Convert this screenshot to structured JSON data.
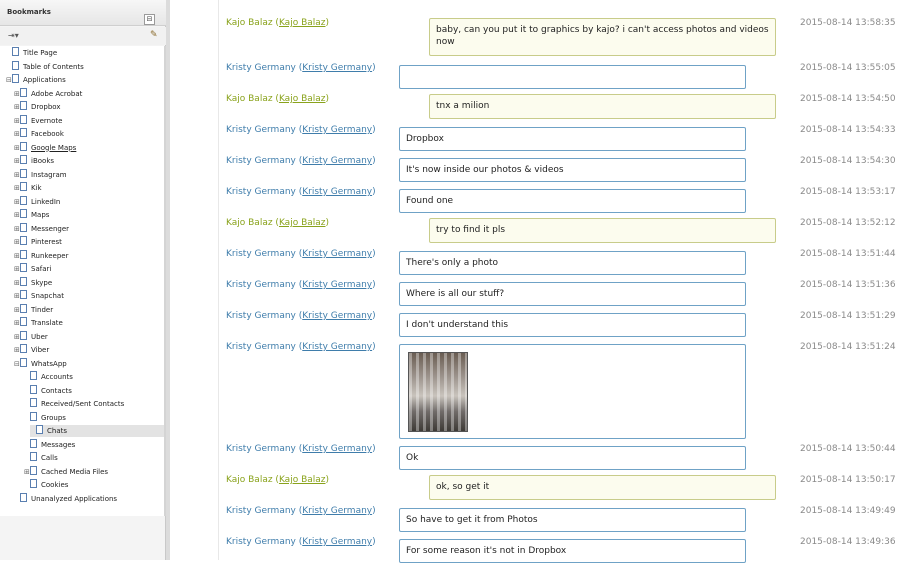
{
  "sidebar": {
    "title": "Bookmarks",
    "header_btn_1": "⊟",
    "header_btn_2": "▸",
    "tool_left": "⇥▾",
    "tool_right": "✎",
    "items": [
      {
        "label": "Title Page",
        "level": 0,
        "exp": ""
      },
      {
        "label": "Table of Contents",
        "level": 0,
        "exp": ""
      },
      {
        "label": "Applications",
        "level": 0,
        "exp": "⊟"
      },
      {
        "label": "Adobe Acrobat",
        "level": 1,
        "exp": "⊞"
      },
      {
        "label": "Dropbox",
        "level": 1,
        "exp": "⊞"
      },
      {
        "label": "Evernote",
        "level": 1,
        "exp": "⊞"
      },
      {
        "label": "Facebook",
        "level": 1,
        "exp": "⊞"
      },
      {
        "label": "Google Maps",
        "level": 1,
        "exp": "⊞",
        "link": true
      },
      {
        "label": "iBooks",
        "level": 1,
        "exp": "⊞"
      },
      {
        "label": "Instagram",
        "level": 1,
        "exp": "⊞"
      },
      {
        "label": "Kik",
        "level": 1,
        "exp": "⊞"
      },
      {
        "label": "LinkedIn",
        "level": 1,
        "exp": "⊞"
      },
      {
        "label": "Maps",
        "level": 1,
        "exp": "⊞"
      },
      {
        "label": "Messenger",
        "level": 1,
        "exp": "⊞"
      },
      {
        "label": "Pinterest",
        "level": 1,
        "exp": "⊞"
      },
      {
        "label": "Runkeeper",
        "level": 1,
        "exp": "⊞"
      },
      {
        "label": "Safari",
        "level": 1,
        "exp": "⊞"
      },
      {
        "label": "Skype",
        "level": 1,
        "exp": "⊞"
      },
      {
        "label": "Snapchat",
        "level": 1,
        "exp": "⊞"
      },
      {
        "label": "Tinder",
        "level": 1,
        "exp": "⊞"
      },
      {
        "label": "Translate",
        "level": 1,
        "exp": "⊞"
      },
      {
        "label": "Uber",
        "level": 1,
        "exp": "⊞"
      },
      {
        "label": "Viber",
        "level": 1,
        "exp": "⊞"
      },
      {
        "label": "WhatsApp",
        "level": 1,
        "exp": "⊟"
      },
      {
        "label": "Accounts",
        "level": 2,
        "exp": ""
      },
      {
        "label": "Contacts",
        "level": 2,
        "exp": ""
      },
      {
        "label": "Received/Sent Contacts",
        "level": 2,
        "exp": ""
      },
      {
        "label": "Groups",
        "level": 2,
        "exp": ""
      },
      {
        "label": "Chats",
        "level": 2,
        "exp": "",
        "selected": true
      },
      {
        "label": "Messages",
        "level": 2,
        "exp": ""
      },
      {
        "label": "Calls",
        "level": 2,
        "exp": ""
      },
      {
        "label": "Cached Media Files",
        "level": 2,
        "exp": "⊞"
      },
      {
        "label": "Cookies",
        "level": 2,
        "exp": ""
      },
      {
        "label": "Unanalyzed Applications",
        "level": 1,
        "exp": ""
      }
    ]
  },
  "chat": {
    "colors": {
      "kajo": "#8aa31c",
      "kristy": "#3f7dab",
      "in_border": "#6fa2c6",
      "out_border": "#c8cc8a"
    },
    "messages": [
      {
        "sender": "Kajo Balaz",
        "account": "Kajo Balaz",
        "dir": "out",
        "text": "baby, can you put it to graphics by kajo? i can't access photos and videos now",
        "time": "2015-08-14 13:58:35"
      },
      {
        "sender": "Kristy Germany",
        "account": "Kristy Germany",
        "dir": "in",
        "text": "",
        "time": "2015-08-14 13:55:05"
      },
      {
        "sender": "Kajo Balaz",
        "account": "Kajo Balaz",
        "dir": "out",
        "text": "tnx a milion",
        "time": "2015-08-14 13:54:50"
      },
      {
        "sender": "Kristy Germany",
        "account": "Kristy Germany",
        "dir": "in",
        "text": "Dropbox",
        "time": "2015-08-14 13:54:33"
      },
      {
        "sender": "Kristy Germany",
        "account": "Kristy Germany",
        "dir": "in",
        "text": "It's now inside our photos & videos",
        "time": "2015-08-14 13:54:30"
      },
      {
        "sender": "Kristy Germany",
        "account": "Kristy Germany",
        "dir": "in",
        "text": "Found one",
        "time": "2015-08-14 13:53:17"
      },
      {
        "sender": "Kajo Balaz",
        "account": "Kajo Balaz",
        "dir": "out",
        "text": "try to find it pls",
        "time": "2015-08-14 13:52:12"
      },
      {
        "sender": "Kristy Germany",
        "account": "Kristy Germany",
        "dir": "in",
        "text": "There's only a photo",
        "time": "2015-08-14 13:51:44"
      },
      {
        "sender": "Kristy Germany",
        "account": "Kristy Germany",
        "dir": "in",
        "text": "Where is all our stuff?",
        "time": "2015-08-14 13:51:36"
      },
      {
        "sender": "Kristy Germany",
        "account": "Kristy Germany",
        "dir": "in",
        "text": "I don't understand this",
        "time": "2015-08-14 13:51:29"
      },
      {
        "sender": "Kristy Germany",
        "account": "Kristy Germany",
        "dir": "in",
        "text": "",
        "image": true,
        "time": "2015-08-14 13:51:24"
      },
      {
        "sender": "Kristy Germany",
        "account": "Kristy Germany",
        "dir": "in",
        "text": "Ok",
        "time": "2015-08-14 13:50:44"
      },
      {
        "sender": "Kajo Balaz",
        "account": "Kajo Balaz",
        "dir": "out",
        "text": "ok, so get it",
        "time": "2015-08-14 13:50:17"
      },
      {
        "sender": "Kristy Germany",
        "account": "Kristy Germany",
        "dir": "in",
        "text": "So have to get it from Photos",
        "time": "2015-08-14 13:49:49"
      },
      {
        "sender": "Kristy Germany",
        "account": "Kristy Germany",
        "dir": "in",
        "text": "For some reason it's not in Dropbox",
        "time": "2015-08-14 13:49:36"
      }
    ]
  }
}
